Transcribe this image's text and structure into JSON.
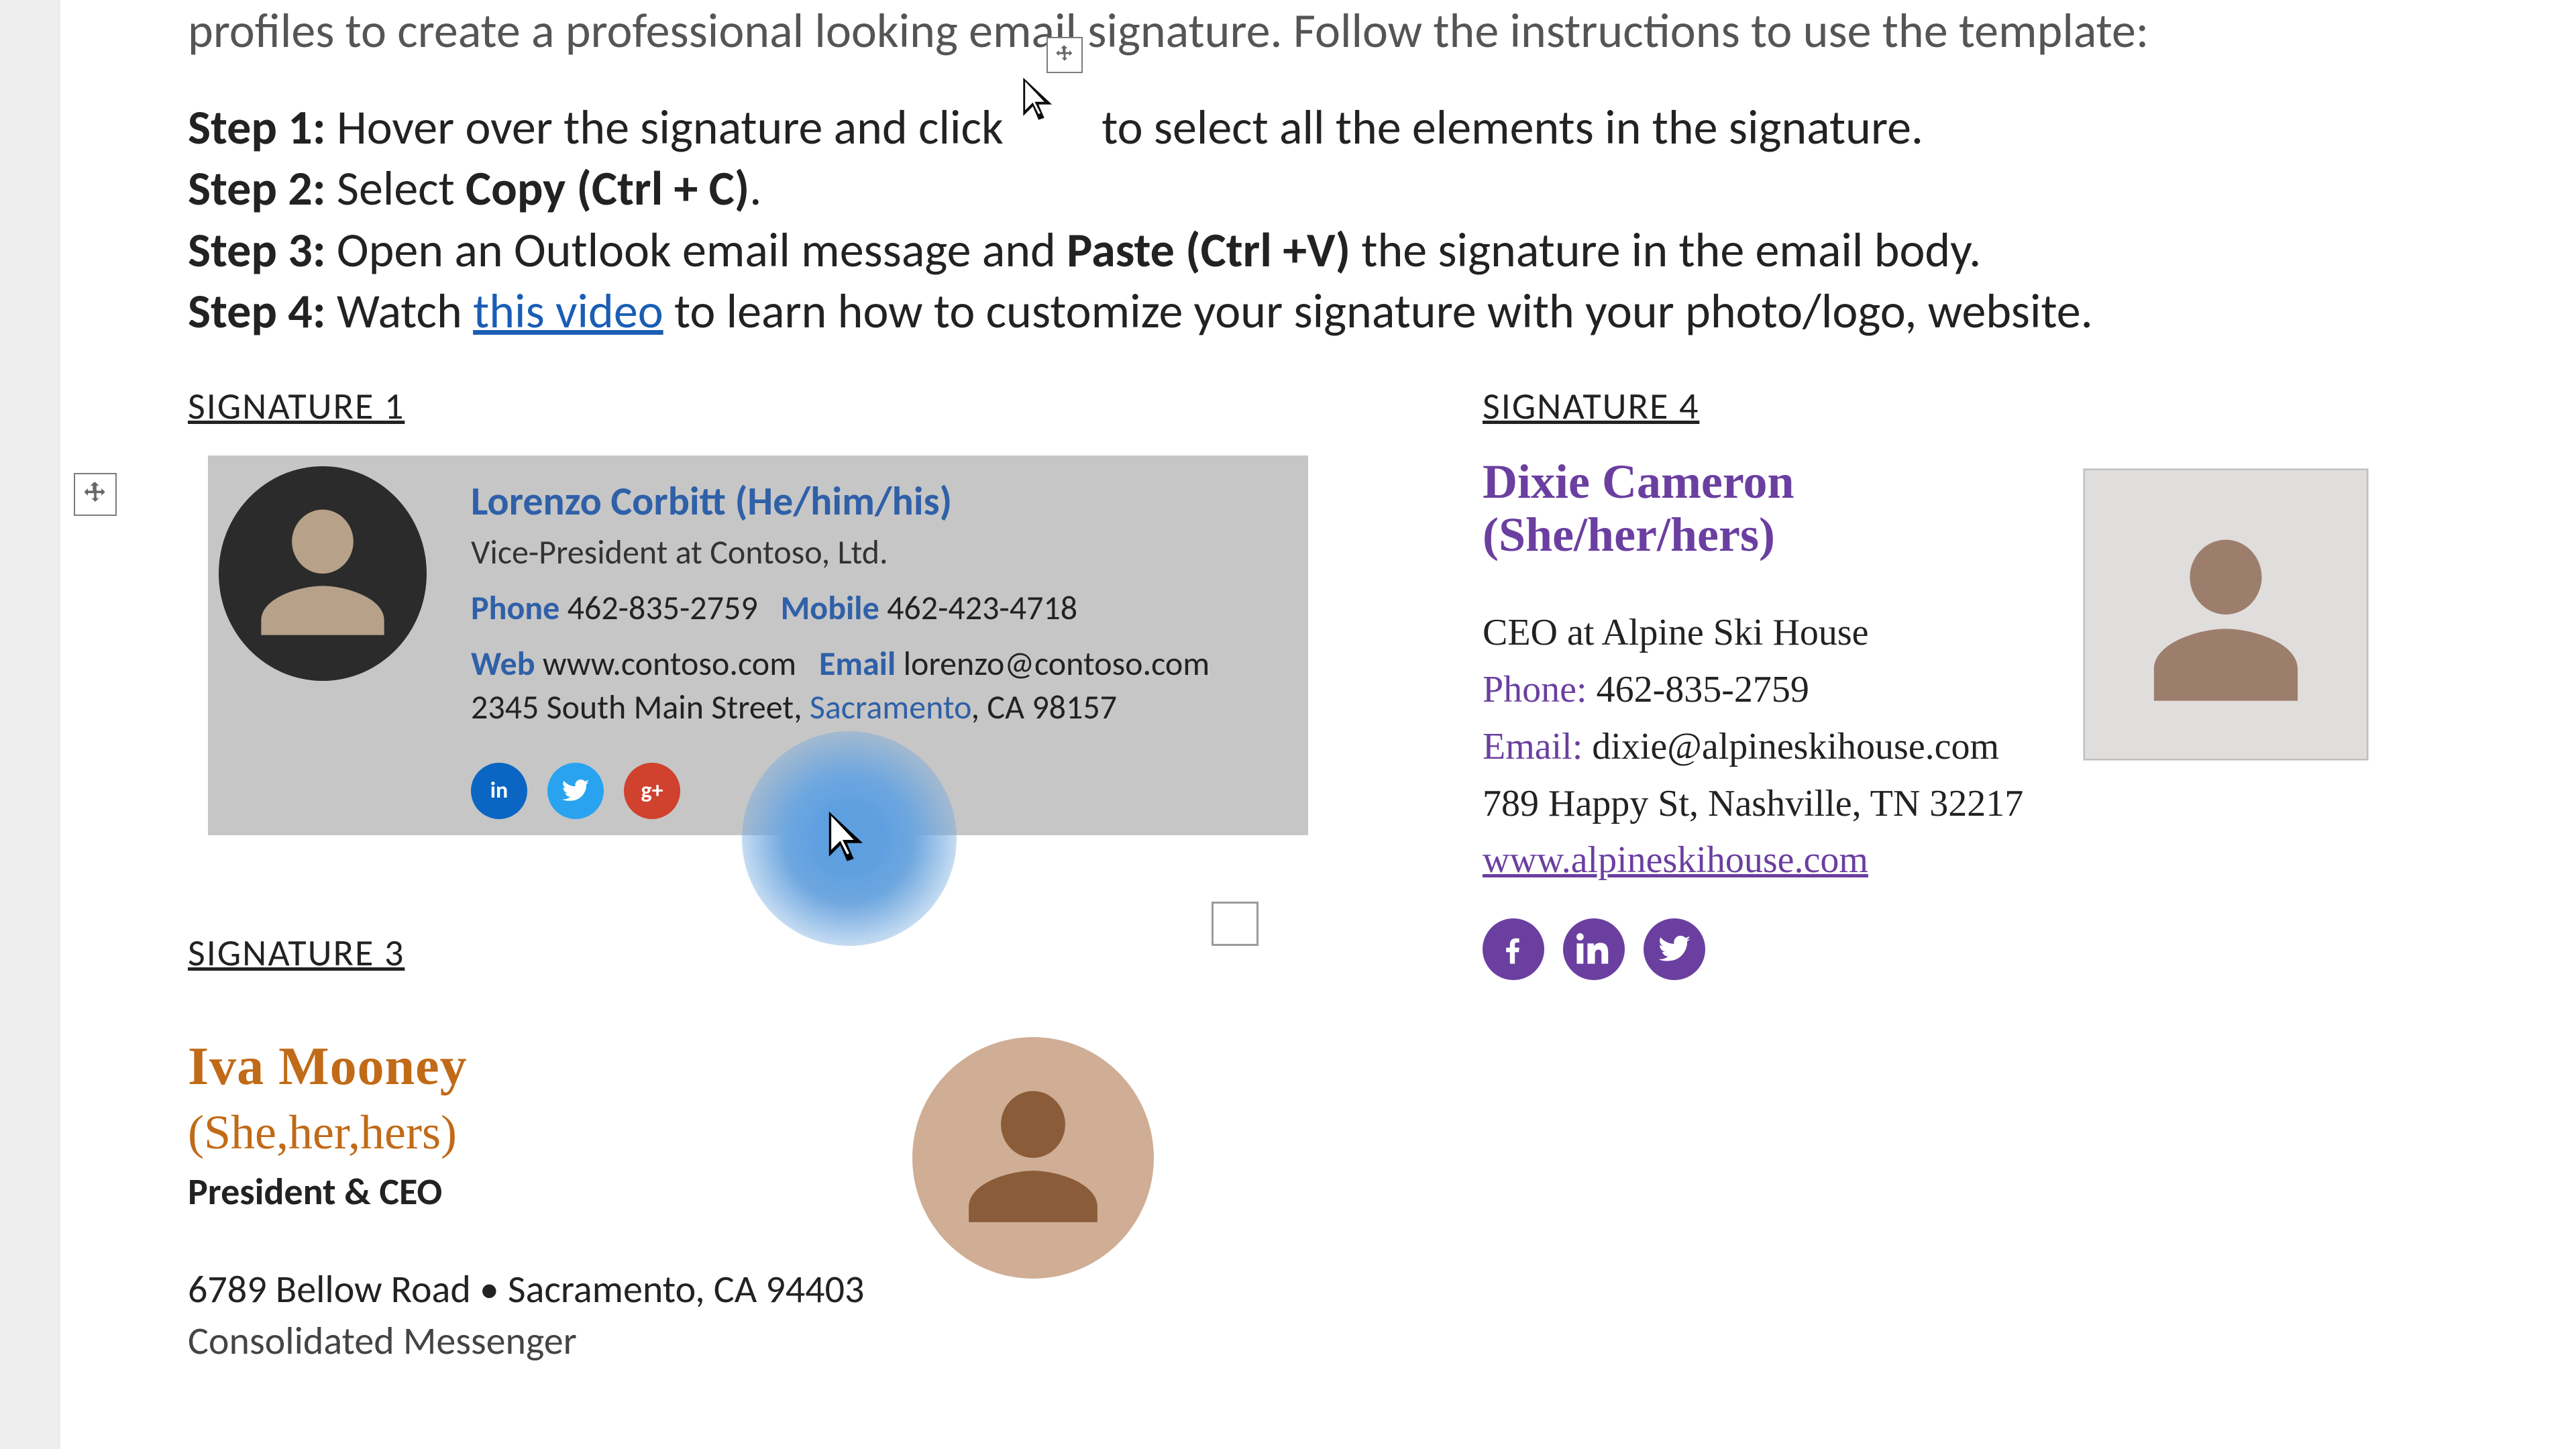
{
  "intro": "profiles to create a professional looking email signature. Follow the instructions to use the template:",
  "steps": {
    "s1": {
      "label": "Step 1:",
      "pre": "Hover over the signature and click",
      "post": "to select all the elements in the signature."
    },
    "s2": {
      "label": "Step 2:",
      "pre": "Select",
      "bold": "Copy (Ctrl + C)",
      "post": "."
    },
    "s3": {
      "label": "Step 3:",
      "pre": "Open an Outlook email message and",
      "bold": "Paste (Ctrl +V)",
      "post": " the signature in the email body."
    },
    "s4": {
      "label": "Step 4:",
      "pre": "Watch ",
      "link": "this video",
      "post": " to learn how to customize your signature with your photo/logo, website."
    }
  },
  "sig1": {
    "heading": "SIGNATURE 1",
    "name": "Lorenzo Corbitt (He/him/his)",
    "title": "Vice-President at Contoso, Ltd.",
    "phone_label": "Phone",
    "phone": "462-835-2759",
    "mobile_label": "Mobile",
    "mobile": "462-423-4718",
    "web_label": "Web",
    "web": "www.contoso.com",
    "email_label": "Email",
    "email": "lorenzo@contoso.com",
    "addr_pre": "2345 South Main Street,",
    "addr_hi": " Sacramento",
    "addr_post": ", CA 98157",
    "soc_in": "in",
    "soc_g": "g+"
  },
  "sig3": {
    "heading": "SIGNATURE 3",
    "name": "Iva Mooney",
    "pron": "(She,her,hers)",
    "role": "President & CEO",
    "addr": "6789 Bellow Road • Sacramento, CA 94403",
    "company": "Consolidated Messenger"
  },
  "sig4": {
    "heading": "SIGNATURE 4",
    "name_line1": "Dixie Cameron",
    "name_line2": "(She/her/hers)",
    "title": "CEO at Alpine Ski House",
    "phone_label": "Phone:",
    "phone": "462-835-2759",
    "email_label": "Email:",
    "email": "dixie@alpineskihouse.com",
    "addr": "789 Happy St, Nashville, TN 32217",
    "web": "www.alpineskihouse.com"
  }
}
